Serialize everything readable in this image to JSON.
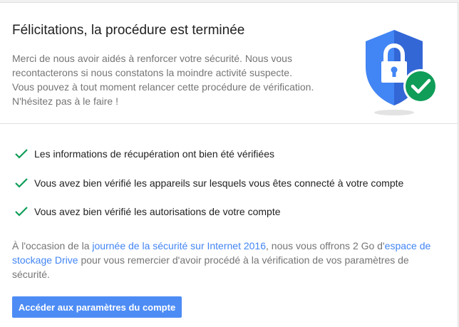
{
  "header": {
    "title": "Félicitations, la procédure est terminée",
    "description_lines": [
      "Merci de nous avoir aidés à renforcer votre sécurité. Nous vous",
      "recontacterons si nous constatons la moindre activité suspecte.",
      "Vous pouvez à tout moment relancer cette procédure de vérification.",
      "N'hésitez pas à le faire !"
    ],
    "icon": "shield-lock-check-icon"
  },
  "checklist": [
    {
      "icon": "checkmark-icon",
      "label": "Les informations de récupération ont bien été vérifiées"
    },
    {
      "icon": "checkmark-icon",
      "label": "Vous avez bien vérifié les appareils sur lesquels vous êtes connecté à votre compte"
    },
    {
      "icon": "checkmark-icon",
      "label": "Vous avez bien vérifié les autorisations de votre compte"
    }
  ],
  "promo": {
    "text_before": "À l'occasion de la ",
    "link1": "journée de la sécurité sur Internet 2016",
    "text_middle": ", nous vous offrons 2 Go d'",
    "link2": "espace de stockage Drive",
    "text_after": " pour vous remercier d'avoir procédé à la vérification de vos paramètres de sécurité."
  },
  "button": {
    "label": "Accéder aux paramètres du compte"
  },
  "colors": {
    "primary": "#4285f4",
    "check_green": "#0f9d58",
    "badge_green": "#0f9d58",
    "shield_blue": "#4285f4",
    "shield_blue_dark": "#3367d6"
  }
}
